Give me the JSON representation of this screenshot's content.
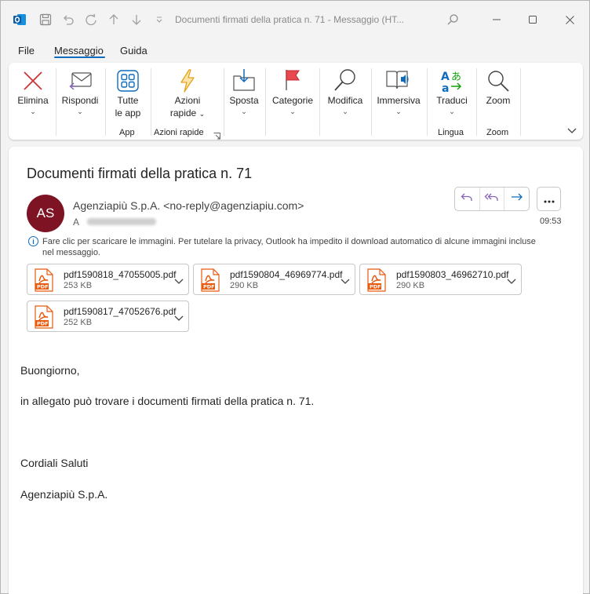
{
  "window": {
    "title": "Documenti firmati della pratica n. 71  -  Messaggio (HT..."
  },
  "menu": {
    "items": [
      "File",
      "Messaggio",
      "Guida"
    ],
    "active": "Messaggio"
  },
  "ribbon": {
    "elimina": "Elimina",
    "rispondi": "Rispondi",
    "tutte_le_app_1": "Tutte",
    "tutte_le_app_2": "le app",
    "azioni_rapide_1": "Azioni",
    "azioni_rapide_2": "rapide",
    "sposta": "Sposta",
    "categorie": "Categorie",
    "modifica": "Modifica",
    "immersiva": "Immersiva",
    "traduci": "Traduci",
    "zoom": "Zoom",
    "groups": {
      "app": "App",
      "azioni_rapide": "Azioni rapide",
      "lingua": "Lingua",
      "zoom": "Zoom"
    }
  },
  "message": {
    "subject": "Documenti firmati della pratica n. 71",
    "avatar_initials": "AS",
    "avatar_color": "#7e1323",
    "sender": "Agenziapiù S.p.A. <no-reply@agenziapiu.com>",
    "to_label": "A",
    "time": "09:53",
    "info_text": "Fare clic per scaricare le immagini. Per tutelare la privacy, Outlook ha impedito il download automatico di alcune immagini incluse nel messaggio.",
    "attachments": [
      {
        "name": "pdf1590818_47055005.pdf",
        "size": "253 KB"
      },
      {
        "name": "pdf1590804_46969774.pdf",
        "size": "290 KB"
      },
      {
        "name": "pdf1590803_46962710.pdf",
        "size": "290 KB"
      },
      {
        "name": "pdf1590817_47052676.pdf",
        "size": "252 KB"
      }
    ],
    "body": {
      "greeting": "Buongiorno,",
      "line1": "in allegato può trovare i documenti firmati della pratica n. 71.",
      "closing": "Cordiali Saluti",
      "signature": "Agenziapiù S.p.A."
    }
  },
  "colors": {
    "accent": "#0f6cbd",
    "reply_accent": "#8764b8",
    "pdf_orange": "#e8590c"
  }
}
